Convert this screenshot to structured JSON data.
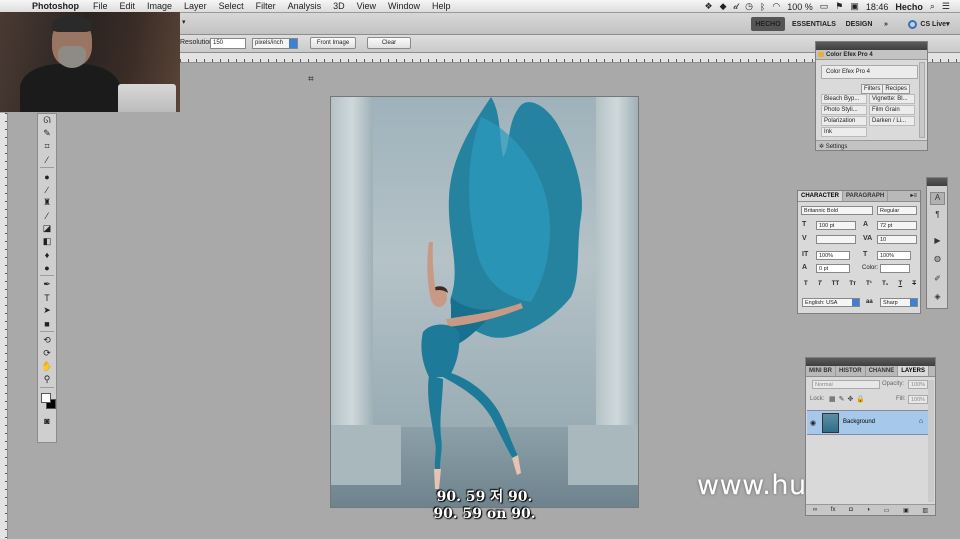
{
  "menubar": {
    "app": "Photoshop",
    "items": [
      "File",
      "Edit",
      "Image",
      "Layer",
      "Select",
      "Filter",
      "Analysis",
      "3D",
      "View",
      "Window",
      "Help"
    ],
    "battery": "100 %",
    "time": "18:46",
    "user": "Hecho"
  },
  "appbar": {
    "workspaces": [
      "HECHO",
      "ESSENTIALS",
      "DESIGN"
    ],
    "more": "»",
    "cslive": "CS Live"
  },
  "options": {
    "resolution_label": "Resolution:",
    "resolution_value": "150",
    "unit": "pixels/inch",
    "front_image": "Front Image",
    "clear": "Clear"
  },
  "efex": {
    "title": "Color Efex Pro 4",
    "header": "Color Efex Pro 4",
    "tab_filters": "Filters",
    "tab_recipes": "Recipes",
    "filters": [
      "Bleach Byp...",
      "Vignette: Bl...",
      "Photo Styli...",
      "Film Grain",
      "Polarization",
      "Darken / Li...",
      "Ink"
    ],
    "settings": "Settings"
  },
  "character": {
    "tab_character": "CHARACTER",
    "tab_paragraph": "PARAGRAPH",
    "font": "Britannic Bold",
    "style": "Regular",
    "size": "100 pt",
    "leading": "72 pt",
    "tracking": "10",
    "vscale": "100%",
    "hscale": "100%",
    "baseline": "0 pt",
    "color_label": "Color:",
    "language": "English: USA",
    "aa_label": "aa",
    "antialias": "Sharp"
  },
  "layers": {
    "tabs": [
      "MINI BR",
      "HISTOR",
      "CHANNE",
      "LAYERS"
    ],
    "blend": "Normal",
    "opacity_label": "Opacity:",
    "opacity": "100%",
    "lock_label": "Lock:",
    "fill_label": "Fill:",
    "fill": "100%",
    "layer_name": "Background"
  },
  "subtitles": {
    "line1": "90. 59 저 90.",
    "line2": "90. 59 on 90."
  },
  "watermark": "www.hunls.com"
}
